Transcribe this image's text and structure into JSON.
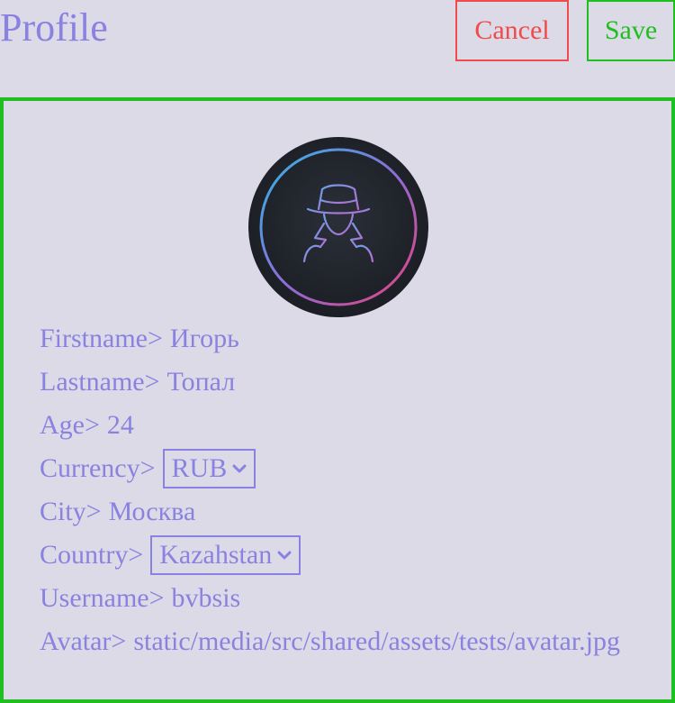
{
  "header": {
    "title": "Profile",
    "cancel_label": "Cancel",
    "save_label": "Save"
  },
  "colors": {
    "background": "#dcdae6",
    "text": "#8a82e0",
    "cancel": "#f04a4a",
    "save": "#1fbf1f"
  },
  "avatar": {
    "icon": "spy-avatar-icon"
  },
  "fields": {
    "firstname": {
      "label": "Firstname>",
      "value": "Игорь"
    },
    "lastname": {
      "label": "Lastname>",
      "value": "Топал"
    },
    "age": {
      "label": "Age>",
      "value": "24"
    },
    "currency": {
      "label": "Currency>",
      "selected": "RUB"
    },
    "city": {
      "label": "City>",
      "value": "Москва"
    },
    "country": {
      "label": "Country>",
      "selected": "Kazahstan"
    },
    "username": {
      "label": "Username>",
      "value": "bvbsis"
    },
    "avatar": {
      "label": "Avatar>",
      "value": "static/media/src/shared/assets/tests/avatar.jpg"
    }
  }
}
